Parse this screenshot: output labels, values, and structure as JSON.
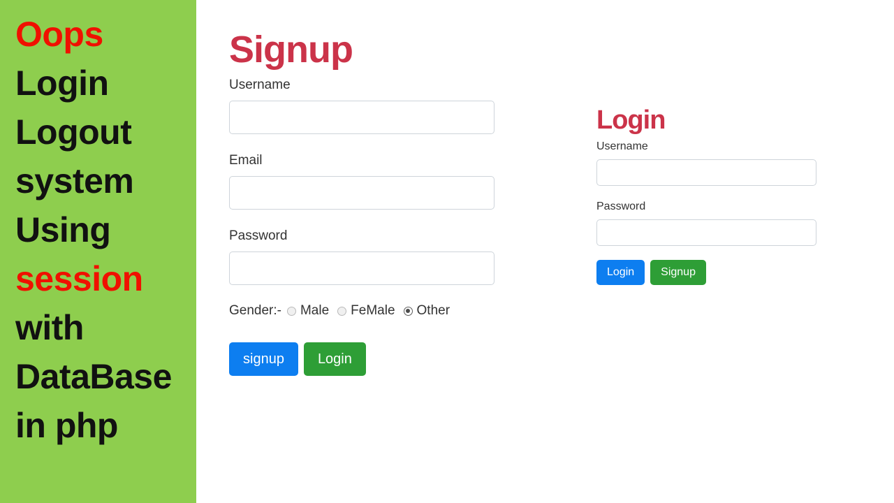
{
  "sidebar": {
    "background_color": "#8ece4e",
    "accent_color": "#f01000",
    "text_color": "#111111",
    "lines": [
      {
        "text": "Oops",
        "accent": true
      },
      {
        "text": "Login",
        "accent": false
      },
      {
        "text": "Logout",
        "accent": false
      },
      {
        "text": "system",
        "accent": false
      },
      {
        "text": "Using",
        "accent": false
      },
      {
        "text": "session",
        "accent": true
      },
      {
        "text": "with",
        "accent": false
      },
      {
        "text": "DataBase",
        "accent": false
      },
      {
        "text": "in php",
        "accent": false
      }
    ]
  },
  "signup_form": {
    "heading": "Signup",
    "heading_color": "#cb3349",
    "username_label": "Username",
    "username_value": "",
    "username_placeholder": "",
    "email_label": "Email",
    "email_value": "",
    "email_placeholder": "",
    "password_label": "Password",
    "password_value": "",
    "password_placeholder": "",
    "gender_prefix": "Gender:-",
    "gender_options": [
      {
        "label": "Male",
        "selected": false
      },
      {
        "label": "FeMale",
        "selected": false
      },
      {
        "label": "Other",
        "selected": true
      }
    ],
    "submit_label": "signup",
    "submit_color": "#0d7ef0",
    "secondary_label": "Login",
    "secondary_color": "#2e9e36"
  },
  "login_form": {
    "heading": "Login",
    "heading_color": "#cb3349",
    "username_label": "Username",
    "username_value": "",
    "username_placeholder": "",
    "password_label": "Password",
    "password_value": "",
    "password_placeholder": "",
    "submit_label": "Login",
    "submit_color": "#0d7ef0",
    "secondary_label": "Signup",
    "secondary_color": "#2e9e36"
  }
}
